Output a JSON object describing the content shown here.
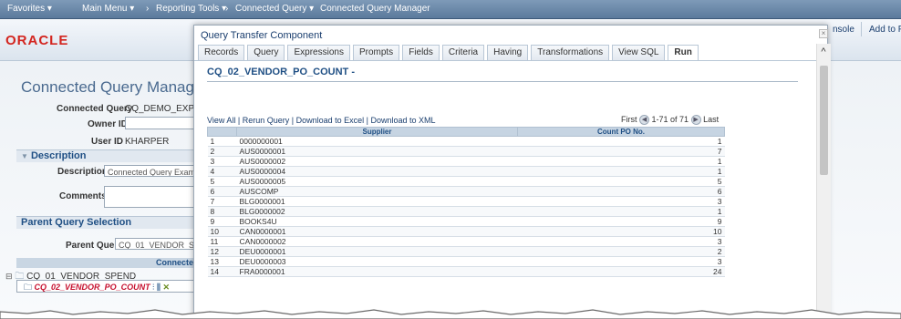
{
  "nav": {
    "favorites": "Favorites ▾",
    "main_menu": "Main Menu ▾",
    "sep1": "›",
    "reporting_tools": "Reporting Tools ▾",
    "sep2": "›",
    "connected_query": "Connected Query ▾",
    "sep3": "›",
    "connected_query_manager": "Connected Query Manager"
  },
  "header": {
    "logo_text": "ORACLE",
    "console_partial": "nsole",
    "add_to_favorites_partial": "Add to Fa"
  },
  "page": {
    "title": "Connected Query Manager",
    "connected_query_label": "Connected Query",
    "connected_query_value": "CQ_DEMO_EXP",
    "owner_id_label": "Owner ID",
    "user_id_label": "User ID",
    "user_id_value": "KHARPER",
    "description_section": "Description",
    "description_label": "Description",
    "description_value": "Connected Query Examp",
    "comments_label": "Comments",
    "parent_section": "Parent Query Selection",
    "parent_query_label": "Parent Query",
    "parent_query_value": "CQ_01_VENDOR_SP",
    "grid_header": "Connecte",
    "tree_root": "CQ_01_VENDOR_SPEND",
    "tree_child": "CQ_02_VENDOR_PO_COUNT"
  },
  "modal": {
    "title": "Query Transfer Component",
    "tabs": [
      "Records",
      "Query",
      "Expressions",
      "Prompts",
      "Fields",
      "Criteria",
      "Having",
      "Transformations",
      "View SQL",
      "Run"
    ],
    "active_tab": "Run",
    "run_title": "CQ_02_VENDOR_PO_COUNT -",
    "links": {
      "view_all": "View All",
      "rerun": "Rerun Query",
      "download_excel": "Download to Excel",
      "download_xml": "Download to XML"
    },
    "pagination": {
      "first": "First",
      "range": "1-71 of 71",
      "last": "Last"
    },
    "table": {
      "headers": [
        "",
        "Supplier",
        "Count PO No."
      ],
      "rows": [
        [
          "1",
          "0000000001",
          "1"
        ],
        [
          "2",
          "AUS0000001",
          "7"
        ],
        [
          "3",
          "AUS0000002",
          "1"
        ],
        [
          "4",
          "AUS0000004",
          "1"
        ],
        [
          "5",
          "AUS0000005",
          "5"
        ],
        [
          "6",
          "AUSCOMP",
          "6"
        ],
        [
          "7",
          "BLG0000001",
          "3"
        ],
        [
          "8",
          "BLG0000002",
          "1"
        ],
        [
          "9",
          "BOOKS4U",
          "9"
        ],
        [
          "10",
          "CAN0000001",
          "10"
        ],
        [
          "11",
          "CAN0000002",
          "3"
        ],
        [
          "12",
          "DEU0000001",
          "2"
        ],
        [
          "13",
          "DEU0000003",
          "3"
        ],
        [
          "14",
          "FRA0000001",
          "24"
        ]
      ]
    }
  },
  "colors": {
    "nav_bar": "#5b7a9c",
    "oracle_red": "#d3251f",
    "link_blue": "#1a3e6e",
    "section_blue": "#1f4f84"
  }
}
